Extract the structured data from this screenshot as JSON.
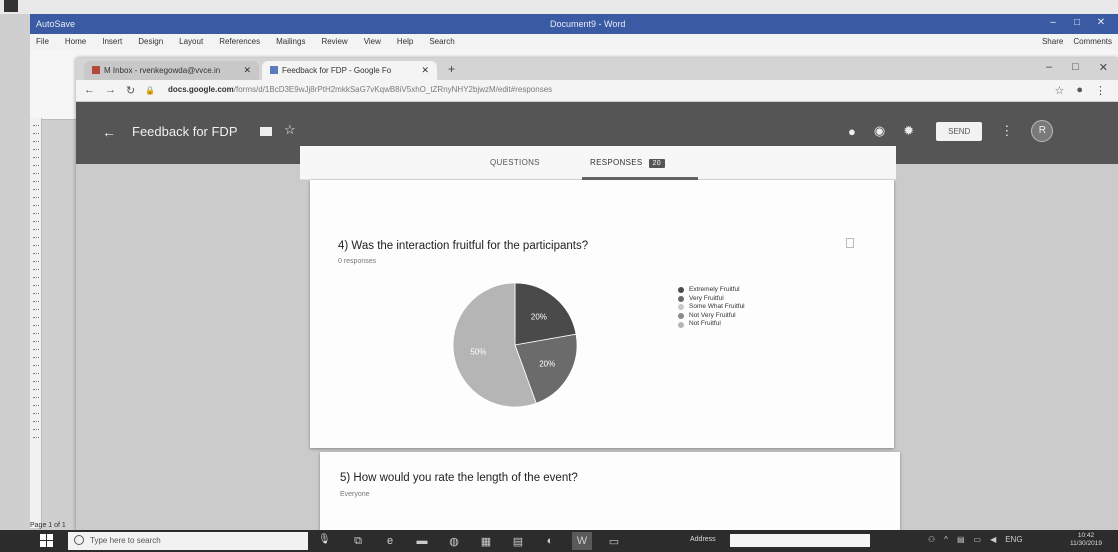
{
  "word": {
    "title_left": "AutoSave",
    "title": "Document9 - Word",
    "menu": [
      "File",
      "Home",
      "Insert",
      "Design",
      "Layout",
      "References",
      "Mailings",
      "Review",
      "View",
      "Help",
      "Search"
    ],
    "share": "Share",
    "comments": "Comments",
    "page_status": "Page 1 of 1",
    "accent": "#3a5aa3"
  },
  "browser": {
    "tabs": [
      {
        "label": "M Inbox - rvenkegowda@vvce.in"
      },
      {
        "label": "Feedback for FDP - Google Fo"
      }
    ],
    "url_host": "docs.google.com",
    "url_path": "/forms/d/1BcD3E9wJj8rPtH2mkkSaG7vKqwB8iV5xhO_tZRnyNHY2bjwzM/edit#responses"
  },
  "forms": {
    "title": "Feedback for FDP",
    "send_label": "SEND",
    "avatar_letter": "R",
    "tab_questions": "QUESTIONS",
    "tab_responses": "RESPONSES",
    "responses_count": "20",
    "q4_title": "4) Was the interaction fruitful for the participants?",
    "q4_sub": "0 responses",
    "q5_title": "5) How would you rate the length of the event?",
    "q5_sub": "Everyone"
  },
  "chart_data": {
    "type": "pie",
    "title": "4) Was the interaction fruitful for the participants?",
    "labels": [
      "Extremely Fruitful",
      "Very Fruitful",
      "Some What Fruitful",
      "Not Very Fruitful",
      "Not Fruitful"
    ],
    "values": [
      20,
      20,
      0,
      0,
      50
    ],
    "slice_labels": [
      "20%",
      "20%",
      "",
      "",
      "50%"
    ],
    "colors": [
      "#4a4a4a",
      "#6b6b6b",
      "#c9c9c9",
      "#8a8a8a",
      "#b5b5b5"
    ],
    "legend": "right"
  },
  "taskbar": {
    "search_placeholder": "Type here to search",
    "address_label": "Address",
    "time": "10:42",
    "date": "11/30/2019"
  }
}
